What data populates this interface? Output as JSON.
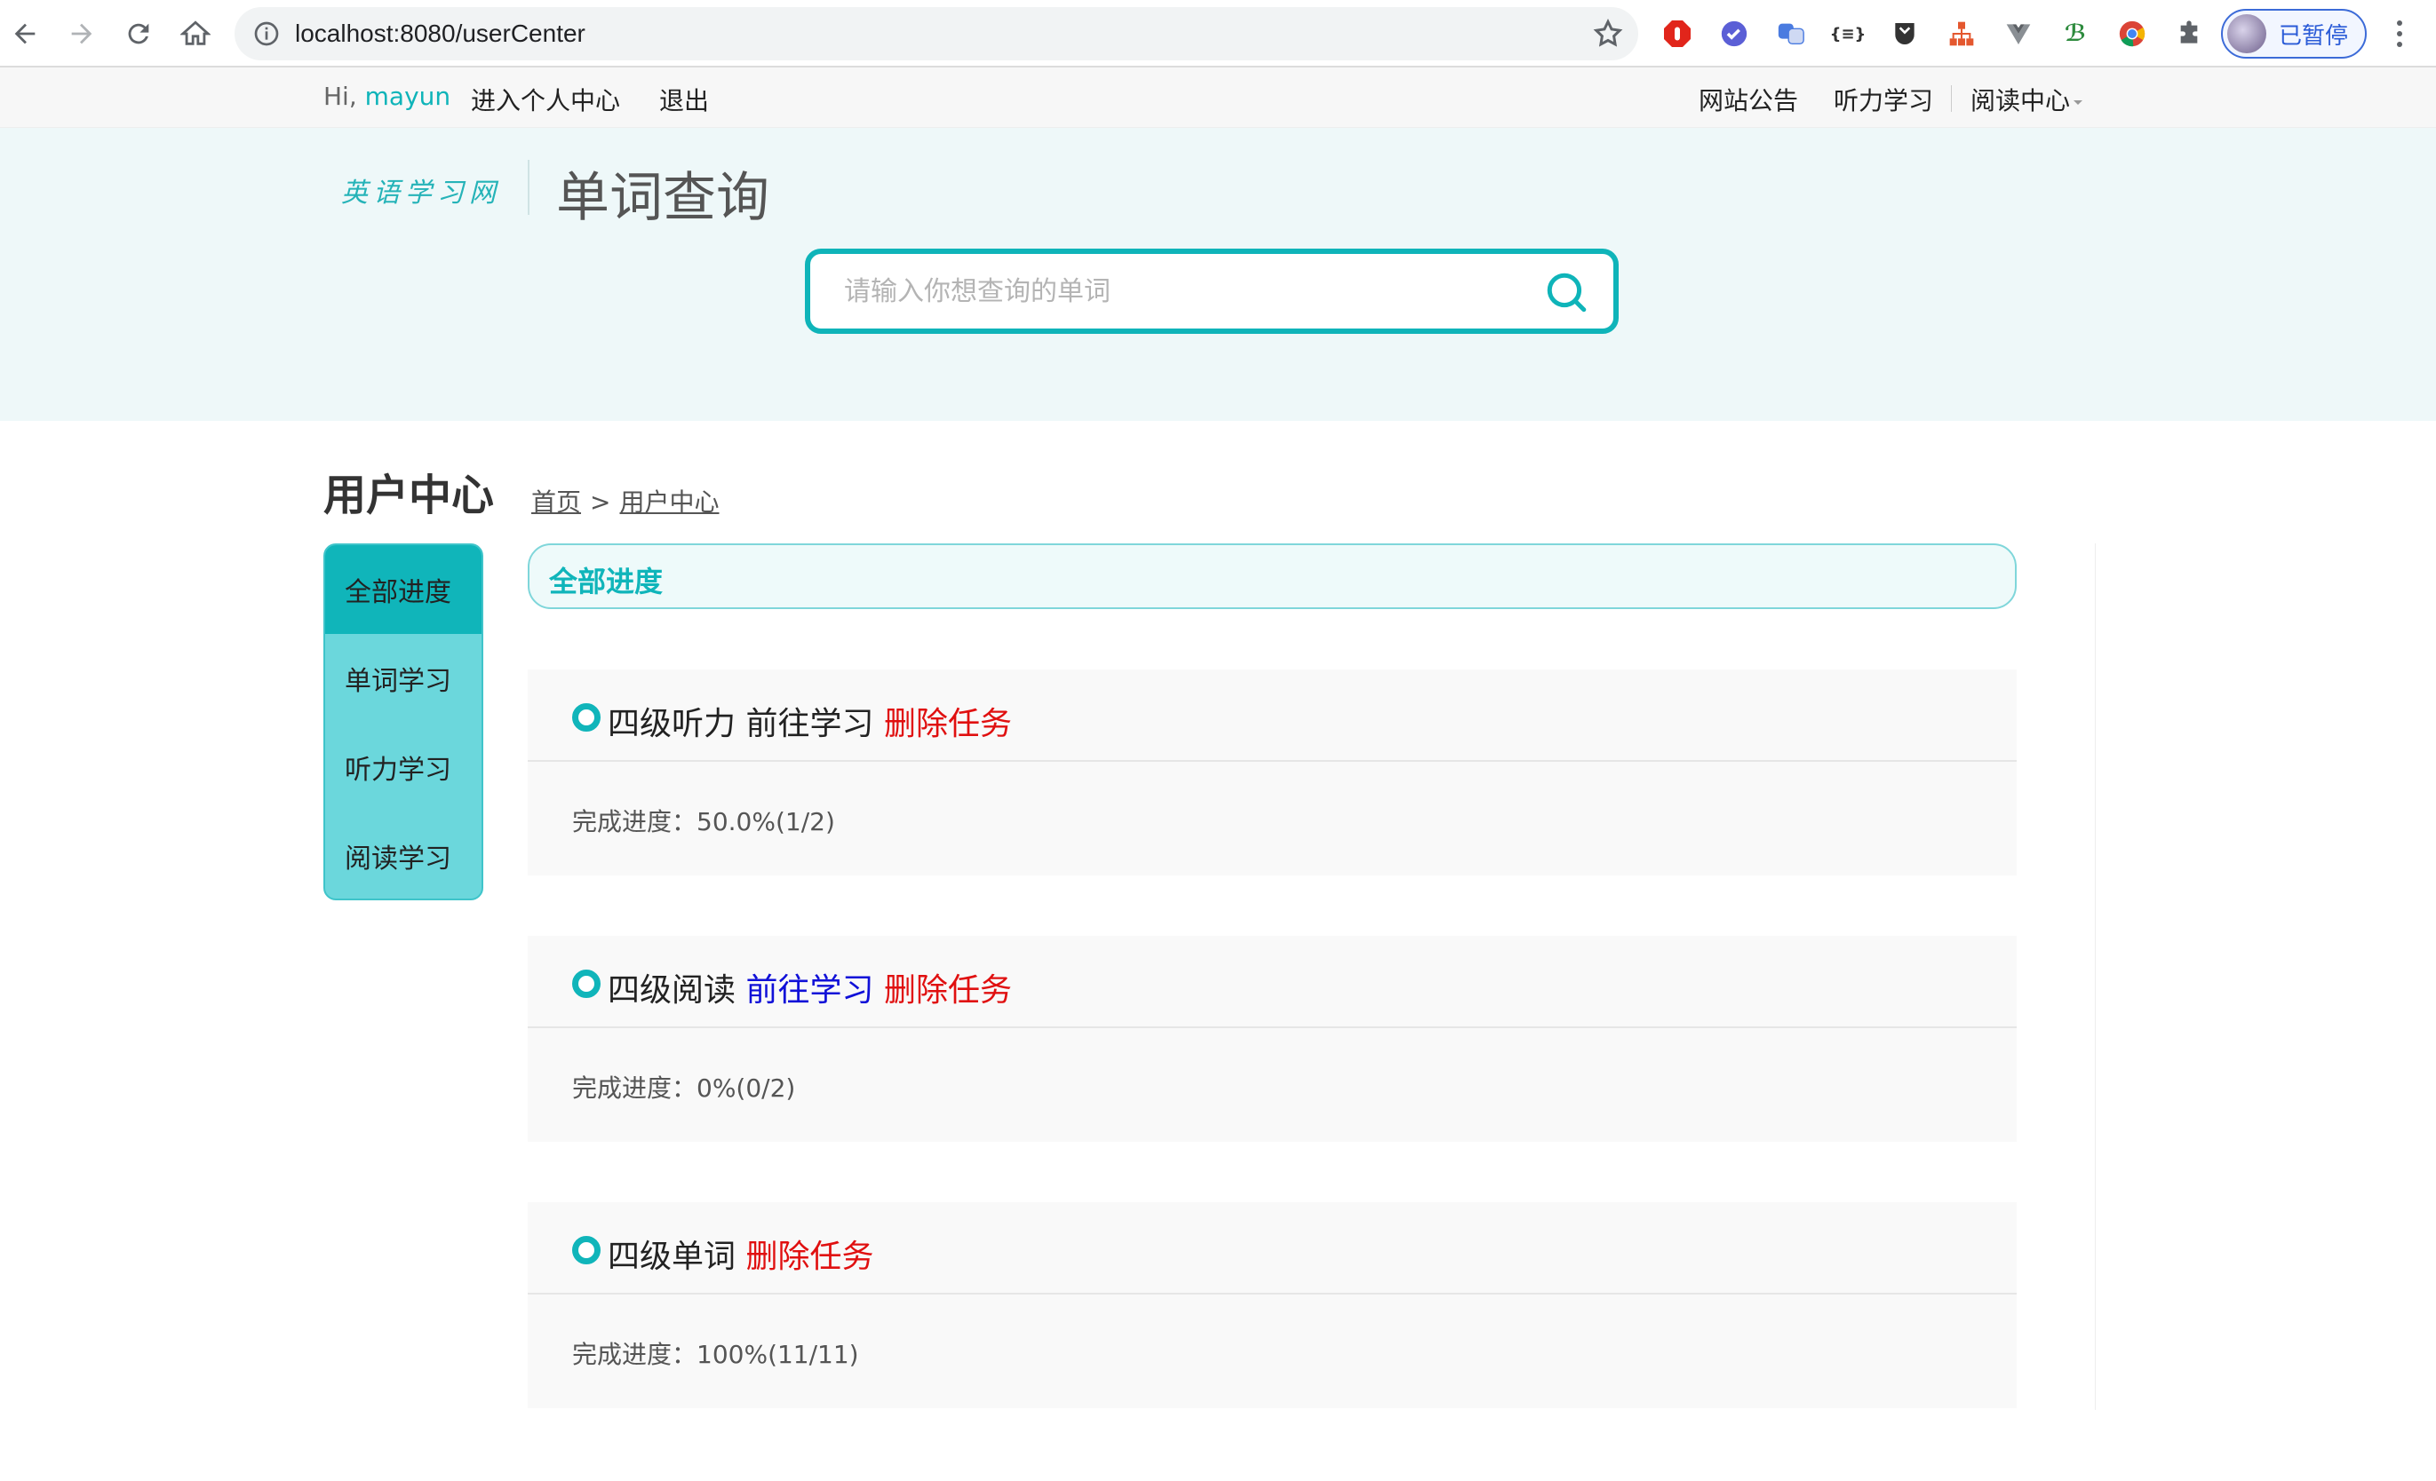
{
  "browser": {
    "url": "localhost:8080/userCenter",
    "profile_label": "已暂停",
    "extensions": [
      "adblock-icon",
      "checkmark-icon",
      "translate-icon",
      "json-icon",
      "shield-icon",
      "sitemap-icon",
      "vue-icon",
      "formula-icon",
      "chrome-icon",
      "puzzle-icon"
    ]
  },
  "topbar": {
    "greeting": "Hi,",
    "username": "mayun",
    "personal_center": "进入个人中心",
    "logout": "退出",
    "announcements": "网站公告",
    "listening": "听力学习",
    "reading_center": "阅读中心"
  },
  "header": {
    "logo": "英语学习网",
    "title": "单词查询",
    "search_placeholder": "请输入你想查询的单词"
  },
  "page": {
    "title": "用户中心",
    "breadcrumb": {
      "home": "首页",
      "separator": ">",
      "current": "用户中心"
    }
  },
  "sidebar": {
    "items": [
      {
        "label": "全部进度",
        "active": true
      },
      {
        "label": "单词学习",
        "active": false
      },
      {
        "label": "听力学习",
        "active": false
      },
      {
        "label": "阅读学习",
        "active": false
      }
    ]
  },
  "panel": {
    "heading": "全部进度",
    "tasks": [
      {
        "name": "四级听力",
        "go": "前往学习",
        "delete": "删除任务",
        "progress_label": "完成进度：",
        "progress": "50.0%(1/2)"
      },
      {
        "name": "四级阅读",
        "go": "前往学习",
        "delete": "删除任务",
        "progress_label": "完成进度：",
        "progress": "0%(0/2)"
      },
      {
        "name": "四级单词",
        "go": "",
        "delete": "删除任务",
        "progress_label": "完成进度：",
        "progress": "100%(11/11)"
      }
    ]
  },
  "colors": {
    "accent": "#10b5ba",
    "sidebar_bg": "#6bd7dc",
    "delete_red": "#e01010",
    "link_blue": "#1010d8"
  }
}
